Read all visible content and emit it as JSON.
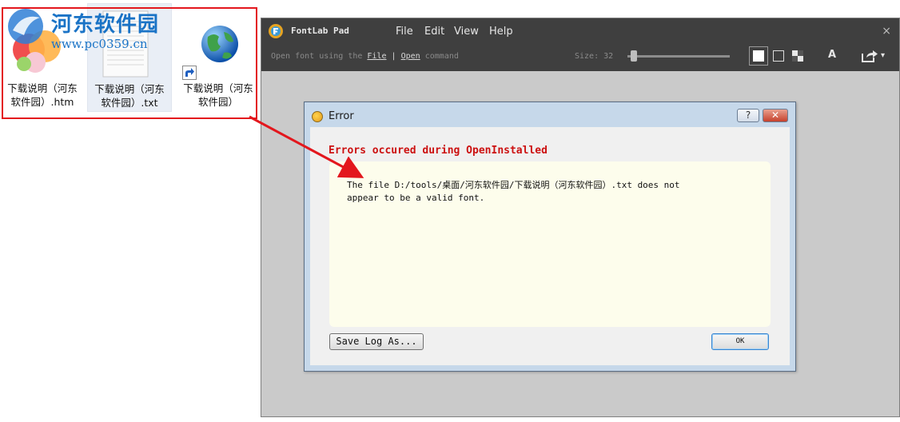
{
  "watermark": {
    "title": "河东软件园",
    "url": "www.pc0359.cn"
  },
  "desktop": {
    "files": [
      {
        "line1": "下载说明（河东",
        "line2": "软件园）.htm",
        "icon": "htm-file-icon"
      },
      {
        "line1": "下载说明（河东",
        "line2": "软件园）.txt",
        "icon": "txt-file-icon"
      },
      {
        "line1": "下载说明（河东",
        "line2": "软件园）",
        "icon": "internet-shortcut-icon"
      }
    ]
  },
  "app": {
    "title": "FontLab Pad",
    "menu": [
      "File",
      "Edit",
      "View",
      "Help"
    ],
    "hint_prefix": "Open font using the",
    "hint_file": "File",
    "hint_sep": "|",
    "hint_open": "Open",
    "hint_suffix": "command",
    "size_label": "Size: 32",
    "close_glyph": "×",
    "text_tool": "A",
    "share_caret": "▾"
  },
  "dialog": {
    "title": "Error",
    "help_label": "?",
    "close_label": "✕",
    "heading": "Errors occured during OpenInstalled",
    "message_line1": "The file D:/tools/桌面/河东软件园/下载说明（河东软件园）.txt does not",
    "message_line2": "appear to be a valid font.",
    "save_button": "Save Log As...",
    "ok_button": "OK"
  },
  "colors": {
    "annotation_red": "#e3171d",
    "error_text": "#cc1111",
    "watermark_blue": "#1a73c6"
  }
}
